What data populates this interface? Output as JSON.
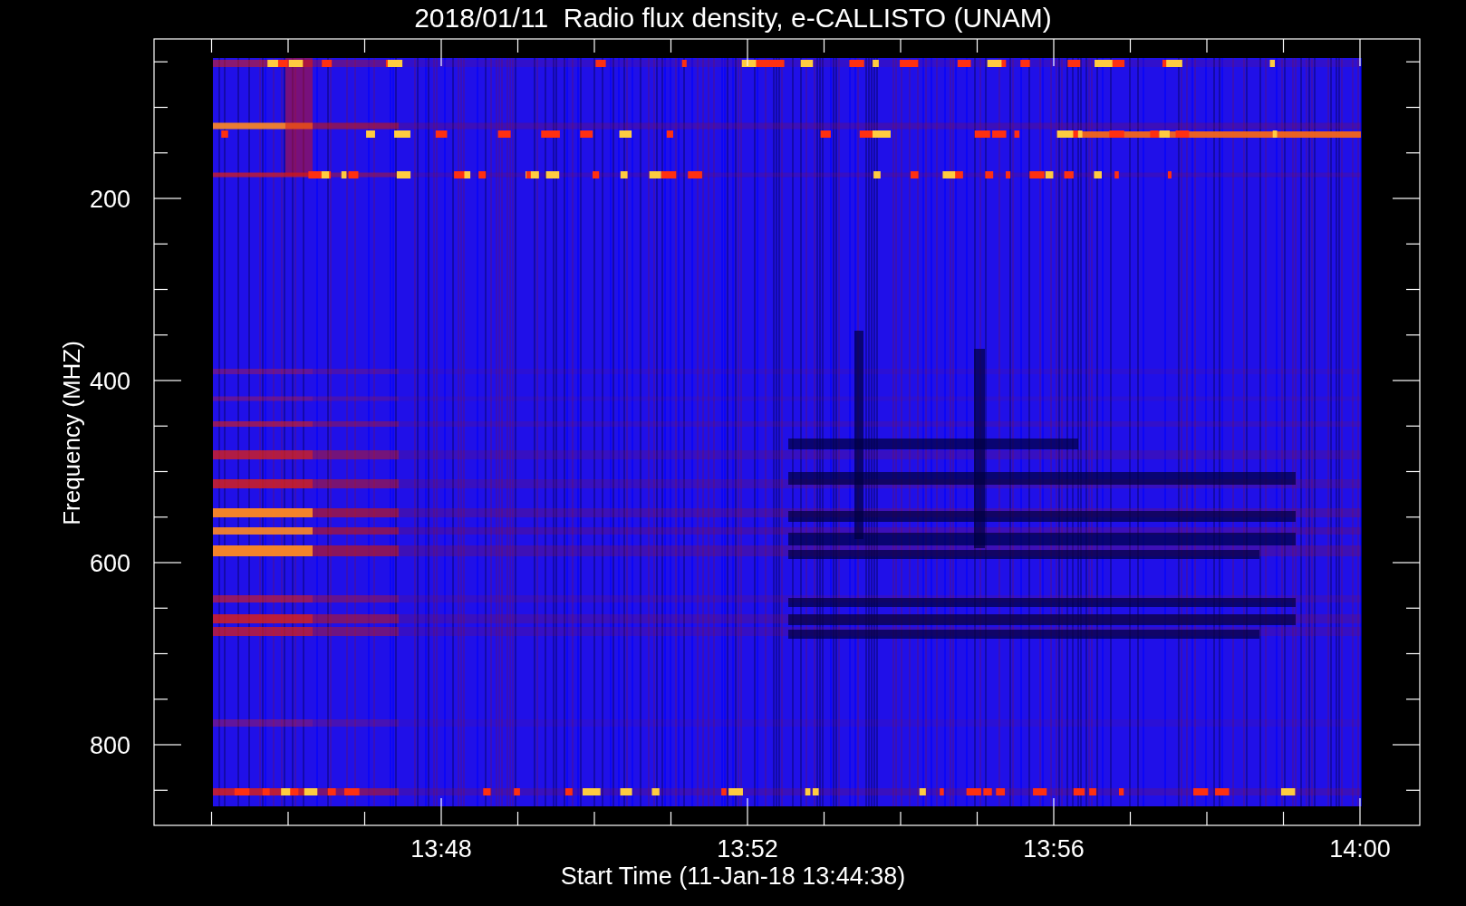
{
  "title": "2018/01/11  Radio flux density, e-CALLISTO (UNAM)",
  "ylabel": "Frequency (MHZ)",
  "xlabel": "Start Time (11-Jan-18 13:44:38)",
  "yticks": [
    "200",
    "400",
    "600",
    "800"
  ],
  "xticks": [
    "13:48",
    "13:52",
    "13:56",
    "14:00"
  ]
}
